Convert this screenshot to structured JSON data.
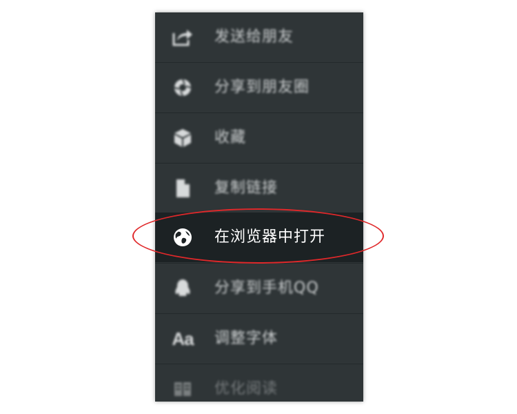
{
  "menu": {
    "items": [
      {
        "label": "发送给朋友",
        "icon": "share-arrow-icon"
      },
      {
        "label": "分享到朋友圈",
        "icon": "moments-aperture-icon"
      },
      {
        "label": "收藏",
        "icon": "cube-icon"
      },
      {
        "label": "复制链接",
        "icon": "document-icon"
      },
      {
        "label": "在浏览器中打开",
        "icon": "globe-icon"
      },
      {
        "label": "分享到手机QQ",
        "icon": "qq-penguin-icon"
      },
      {
        "label": "调整字体",
        "icon": "font-aa-icon",
        "icon_text": "Aa"
      },
      {
        "label": "优化阅读",
        "icon": "reader-icon"
      }
    ]
  },
  "colors": {
    "menu_bg": "#2f3537",
    "highlight_bg": "#1c2224",
    "annotation": "#e0282a"
  }
}
